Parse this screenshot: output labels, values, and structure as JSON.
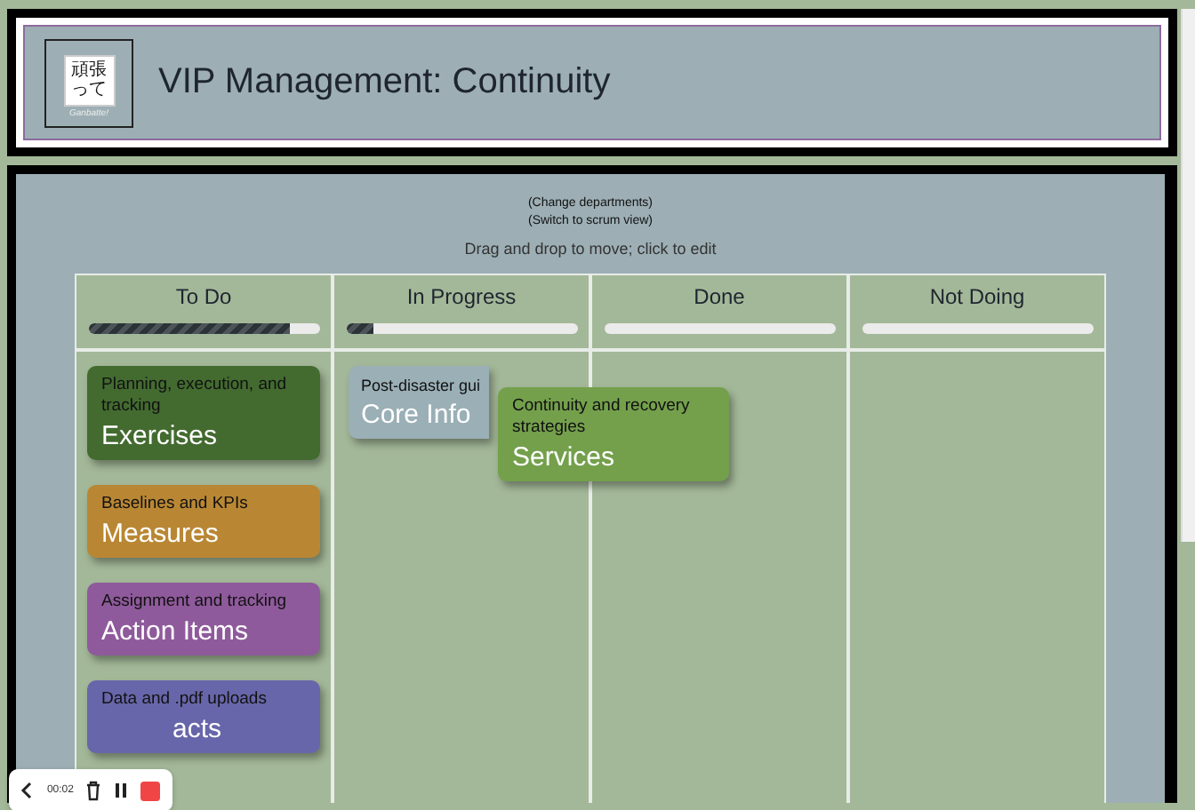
{
  "header": {
    "logo": {
      "text": "頑張って",
      "caption": "Ganbatte!"
    },
    "title": "VIP Management: Continuity"
  },
  "links": [
    "(Change departments)",
    "(Switch to scrum view)"
  ],
  "instructions": "Drag and drop to move; click to edit",
  "columns": [
    {
      "title": "To Do",
      "level": 0.87,
      "cards": [
        {
          "subtitle": "Planning, execution, and tracking",
          "title": "Exercises",
          "color": "#436b30"
        },
        {
          "subtitle": "Baselines and KPIs",
          "title": "Measures",
          "color": "#b98734"
        },
        {
          "subtitle": "Assignment and tracking",
          "title": "Action Items",
          "color": "#8f5a9c"
        },
        {
          "subtitle": "Data and .pdf uploads",
          "title": "acts",
          "color": "#6866aa"
        }
      ]
    },
    {
      "title": "In Progress",
      "level": 0.12,
      "cards": [
        {
          "subtitle": "Post-disaster gui",
          "title": "Core Info",
          "color": "#9aafb6"
        }
      ]
    },
    {
      "title": "Done",
      "level": 0
    },
    {
      "title": "Not Doing",
      "level": 0
    }
  ],
  "dragged_card": {
    "subtitle": "Continuity and recovery strategies",
    "title": "Services",
    "color": "#74a04c"
  },
  "recorder": {
    "time": "00:02"
  }
}
